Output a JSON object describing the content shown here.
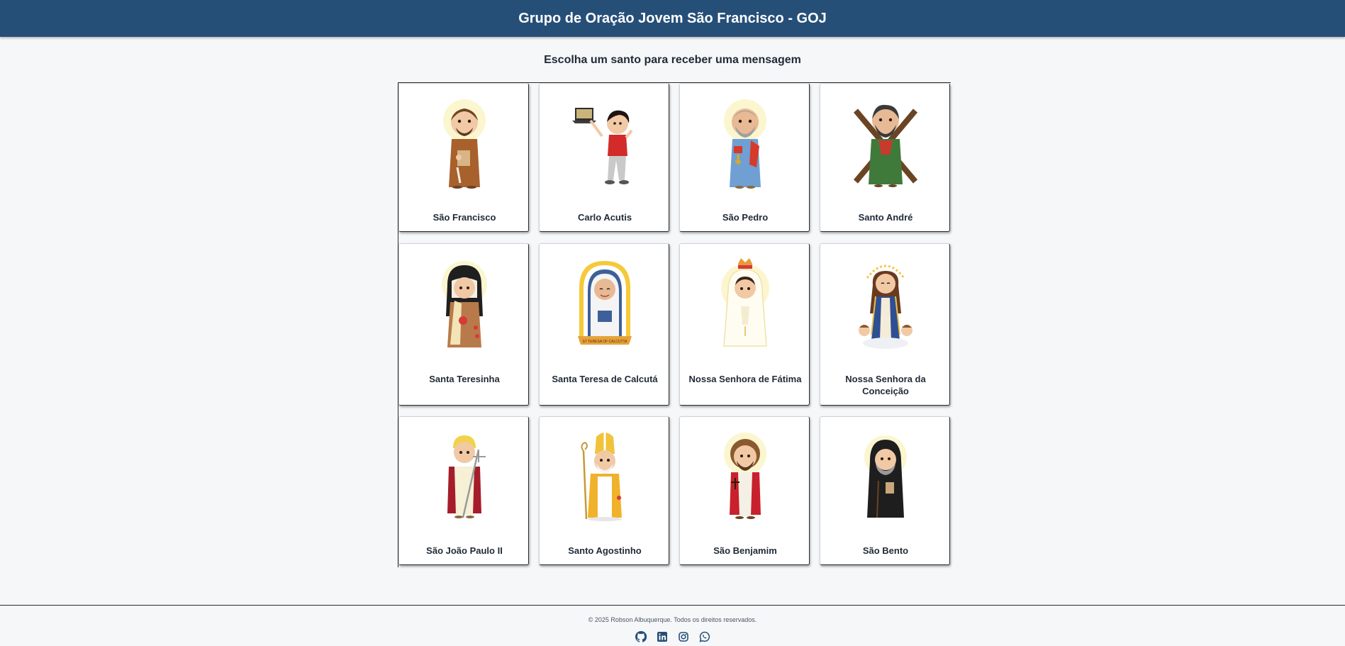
{
  "header": {
    "title": "Grupo de Oração Jovem São Francisco - GOJ",
    "bg_color": "#264f78"
  },
  "main": {
    "heading": "Escolha um santo para receber uma mensagem"
  },
  "saints": [
    {
      "name": "São Francisco",
      "icon": "sao-francisco-illustration"
    },
    {
      "name": "Carlo Acutis",
      "icon": "carlo-acutis-illustration"
    },
    {
      "name": "São Pedro",
      "icon": "sao-pedro-illustration"
    },
    {
      "name": "Santo André",
      "icon": "santo-andre-illustration"
    },
    {
      "name": "Santa Teresinha",
      "icon": "santa-teresinha-illustration"
    },
    {
      "name": "Santa Teresa de Calcutá",
      "icon": "santa-teresa-de-calcuta-illustration",
      "banner_text": "ST TERESA OF CALCUTTA"
    },
    {
      "name": "Nossa Senhora de Fátima",
      "icon": "nossa-senhora-de-fatima-illustration"
    },
    {
      "name": "Nossa Senhora da Conceição",
      "icon": "nossa-senhora-da-conceicao-illustration"
    },
    {
      "name": "São João Paulo II",
      "icon": "sao-joao-paulo-ii-illustration"
    },
    {
      "name": "Santo Agostinho",
      "icon": "santo-agostinho-illustration"
    },
    {
      "name": "São Benjamim",
      "icon": "sao-benjamim-illustration"
    },
    {
      "name": "São Bento",
      "icon": "sao-bento-illustration"
    }
  ],
  "footer": {
    "copyright": "© 2025 Robson Albuquerque. Todos os direitos reservados.",
    "social": [
      "github-icon",
      "linkedin-icon",
      "instagram-icon",
      "whatsapp-icon"
    ]
  }
}
